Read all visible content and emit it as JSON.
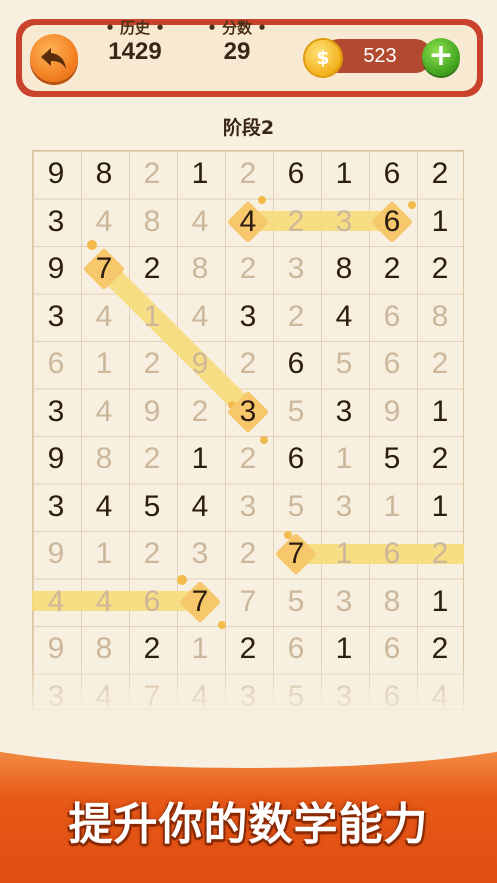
{
  "header": {
    "history_label": "• 历史 •",
    "history_value": "1429",
    "score_label": "• 分数 •",
    "score_value": "29",
    "coin_symbol": "$",
    "coins": "523",
    "add_symbol": "+"
  },
  "stage": {
    "label": "阶段2"
  },
  "board": {
    "rows": [
      [
        "9",
        "8",
        "2",
        "1",
        "2",
        "6",
        "1",
        "6",
        "2"
      ],
      [
        "3",
        "4",
        "8",
        "4",
        "4",
        "2",
        "3",
        "6",
        "1"
      ],
      [
        "9",
        "7",
        "2",
        "8",
        "2",
        "3",
        "8",
        "2",
        "2"
      ],
      [
        "3",
        "4",
        "1",
        "4",
        "3",
        "2",
        "4",
        "6",
        "8"
      ],
      [
        "6",
        "1",
        "2",
        "9",
        "2",
        "6",
        "5",
        "6",
        "2"
      ],
      [
        "3",
        "4",
        "9",
        "2",
        "3",
        "5",
        "3",
        "9",
        "1"
      ],
      [
        "9",
        "8",
        "2",
        "1",
        "2",
        "6",
        "1",
        "5",
        "2"
      ],
      [
        "3",
        "4",
        "5",
        "4",
        "3",
        "5",
        "3",
        "1",
        "1"
      ],
      [
        "9",
        "1",
        "2",
        "3",
        "2",
        "7",
        "1",
        "6",
        "2"
      ],
      [
        "4",
        "4",
        "6",
        "7",
        "7",
        "5",
        "3",
        "8",
        "1"
      ],
      [
        "9",
        "8",
        "2",
        "1",
        "2",
        "6",
        "1",
        "6",
        "2"
      ],
      [
        "3",
        "4",
        "7",
        "4",
        "3",
        "5",
        "3",
        "6",
        "4"
      ]
    ],
    "states": [
      [
        "a",
        "a",
        "u",
        "a",
        "u",
        "a",
        "a",
        "a",
        "a"
      ],
      [
        "a",
        "u",
        "u",
        "u",
        "s",
        "u",
        "u",
        "s",
        "a"
      ],
      [
        "a",
        "s",
        "a",
        "u",
        "u",
        "u",
        "a",
        "a",
        "a"
      ],
      [
        "a",
        "u",
        "u",
        "u",
        "a",
        "u",
        "a",
        "u",
        "u"
      ],
      [
        "u",
        "u",
        "u",
        "u",
        "u",
        "a",
        "u",
        "u",
        "u"
      ],
      [
        "a",
        "u",
        "u",
        "u",
        "s",
        "u",
        "a",
        "u",
        "a"
      ],
      [
        "a",
        "u",
        "u",
        "a",
        "u",
        "a",
        "u",
        "a",
        "a"
      ],
      [
        "a",
        "a",
        "a",
        "a",
        "u",
        "u",
        "u",
        "u",
        "a"
      ],
      [
        "u",
        "u",
        "u",
        "u",
        "u",
        "s",
        "u",
        "u",
        "u"
      ],
      [
        "u",
        "u",
        "u",
        "s",
        "u",
        "u",
        "u",
        "u",
        "a"
      ],
      [
        "u",
        "u",
        "a",
        "u",
        "a",
        "u",
        "a",
        "u",
        "a"
      ],
      [
        "u",
        "u",
        "u",
        "u",
        "u",
        "u",
        "u",
        "u",
        "u"
      ]
    ],
    "colors": {
      "active": "#2c1d10",
      "used": "#cdb79b",
      "highlight": "#f8dc7a"
    }
  },
  "banner": {
    "text": "提升你的数学能力"
  }
}
